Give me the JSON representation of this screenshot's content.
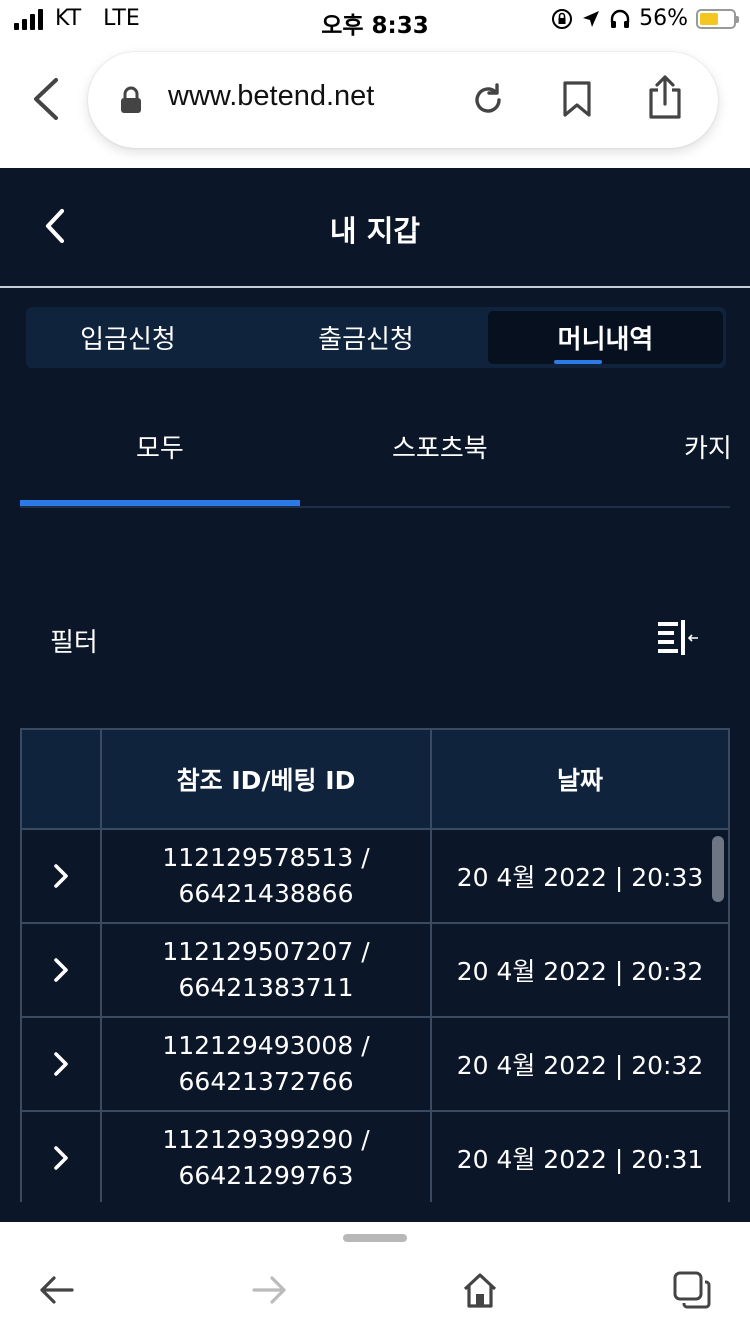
{
  "status_bar": {
    "carrier": "KT",
    "network": "LTE",
    "time": "오후 8:33",
    "battery_percent": "56%",
    "battery_level": 0.56
  },
  "browser": {
    "url": "www.betend.net"
  },
  "header": {
    "title": "내 지갑"
  },
  "segment_tabs": [
    {
      "label": "입금신청",
      "active": false
    },
    {
      "label": "출금신청",
      "active": false
    },
    {
      "label": "머니내역",
      "active": true
    }
  ],
  "category_tabs": [
    {
      "label": "모두",
      "active": true
    },
    {
      "label": "스포츠북",
      "active": false
    },
    {
      "label": "카지",
      "active": false
    }
  ],
  "filter": {
    "label": "필터"
  },
  "table": {
    "headers": [
      "",
      "참조 ID/베팅 ID",
      "날짜"
    ],
    "rows": [
      {
        "ref_id": "112129578513 /",
        "bet_id": "66421438866",
        "date": "20 4월 2022 | 20:33"
      },
      {
        "ref_id": "112129507207 /",
        "bet_id": "66421383711",
        "date": "20 4월 2022 | 20:32"
      },
      {
        "ref_id": "112129493008 /",
        "bet_id": "66421372766",
        "date": "20 4월 2022 | 20:32"
      },
      {
        "ref_id": "112129399290 /",
        "bet_id": "66421299763",
        "date": "20 4월 2022 | 20:31"
      }
    ]
  },
  "colors": {
    "background": "#0b1628",
    "panel": "#10233d",
    "accent": "#2b7ae6",
    "border": "#3a4a61"
  }
}
